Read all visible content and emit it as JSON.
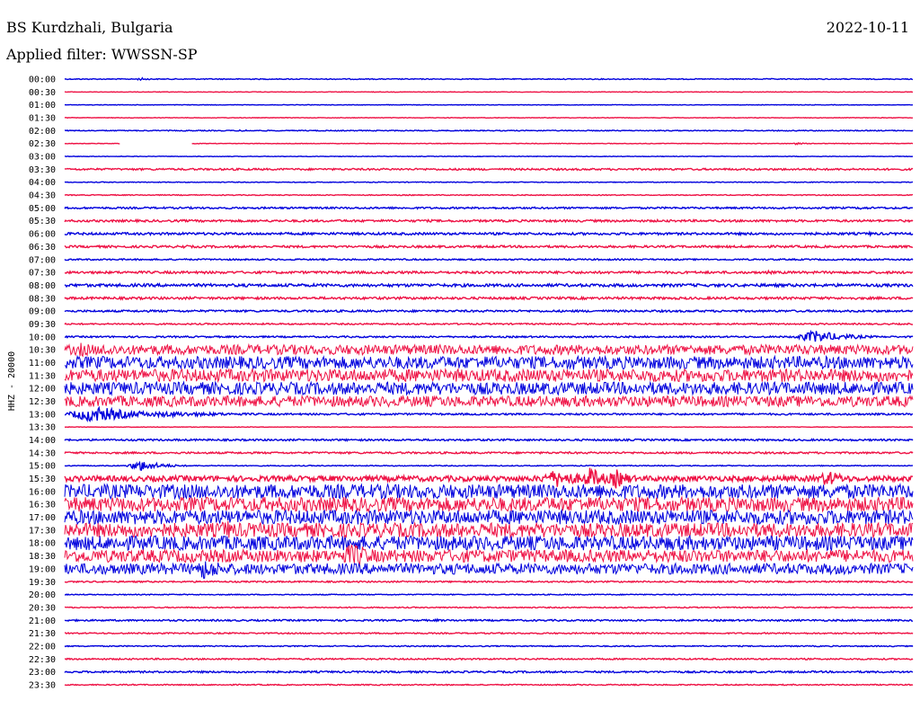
{
  "header": {
    "station": "BS Kurdzhali, Bulgaria",
    "date": "2022-10-11",
    "filter": "Applied filter: WWSSN-SP"
  },
  "chart_data": {
    "type": "line",
    "title": "BS Kurdzhali, Bulgaria",
    "ylabel": "HHZ - 20000",
    "colors": {
      "even": "#0000dd",
      "odd": "#ee1144"
    },
    "rows": [
      {
        "label": "00:00",
        "amp": 0.5,
        "events": [
          {
            "x": 0.09,
            "a": 1.5,
            "w": 0.01
          }
        ]
      },
      {
        "label": "00:30",
        "amp": 0.3,
        "events": []
      },
      {
        "label": "01:00",
        "amp": 0.3,
        "events": []
      },
      {
        "label": "01:30",
        "amp": 0.3,
        "events": []
      },
      {
        "label": "02:00",
        "amp": 0.5,
        "events": [
          {
            "x": 0.21,
            "a": 1.2,
            "w": 0.01
          }
        ]
      },
      {
        "label": "02:30",
        "amp": 0.3,
        "events": [
          {
            "x": 0.86,
            "a": 1.2,
            "w": 0.01
          }
        ],
        "gap": [
          0.065,
          0.15
        ]
      },
      {
        "label": "03:00",
        "amp": 0.3,
        "events": []
      },
      {
        "label": "03:30",
        "amp": 1.0,
        "events": []
      },
      {
        "label": "04:00",
        "amp": 0.4,
        "events": []
      },
      {
        "label": "04:30",
        "amp": 0.5,
        "events": []
      },
      {
        "label": "05:00",
        "amp": 1.0,
        "events": [
          {
            "x": 0.94,
            "a": 2,
            "w": 0.01
          }
        ]
      },
      {
        "label": "05:30",
        "amp": 1.2,
        "events": []
      },
      {
        "label": "06:00",
        "amp": 1.3,
        "events": [
          {
            "x": 0.95,
            "a": 2,
            "w": 0.01
          }
        ]
      },
      {
        "label": "06:30",
        "amp": 1.2,
        "events": [
          {
            "x": 0.14,
            "a": 2,
            "w": 0.01
          }
        ]
      },
      {
        "label": "07:00",
        "amp": 0.8,
        "events": []
      },
      {
        "label": "07:30",
        "amp": 1.3,
        "events": [
          {
            "x": 0.83,
            "a": 2,
            "w": 0.01
          }
        ]
      },
      {
        "label": "08:00",
        "amp": 1.6,
        "events": []
      },
      {
        "label": "08:30",
        "amp": 1.3,
        "events": []
      },
      {
        "label": "09:00",
        "amp": 1.1,
        "events": []
      },
      {
        "label": "09:30",
        "amp": 0.8,
        "events": []
      },
      {
        "label": "10:00",
        "amp": 0.9,
        "events": [
          {
            "x": 0.885,
            "a": 7,
            "w": 0.03
          }
        ]
      },
      {
        "label": "10:30",
        "amp": 5.5,
        "events": [
          {
            "x": 0.02,
            "a": 8,
            "w": 0.03
          },
          {
            "x": 0.05,
            "a": 9,
            "w": 0.015
          }
        ]
      },
      {
        "label": "11:00",
        "amp": 7.0,
        "events": [
          {
            "x": 0.6,
            "a": 9,
            "w": 0.01
          }
        ]
      },
      {
        "label": "11:30",
        "amp": 7.0,
        "events": []
      },
      {
        "label": "12:00",
        "amp": 7.0,
        "events": []
      },
      {
        "label": "12:30",
        "amp": 6.0,
        "events": []
      },
      {
        "label": "13:00",
        "amp": 1.0,
        "events": [
          {
            "x": 0.035,
            "a": 9,
            "w": 0.04
          },
          {
            "x": 0.12,
            "a": 3,
            "w": 0.08
          }
        ]
      },
      {
        "label": "13:30",
        "amp": 0.3,
        "events": []
      },
      {
        "label": "14:00",
        "amp": 1.0,
        "events": []
      },
      {
        "label": "14:30",
        "amp": 1.0,
        "events": []
      },
      {
        "label": "15:00",
        "amp": 0.5,
        "events": [
          {
            "x": 0.09,
            "a": 6,
            "w": 0.02
          }
        ]
      },
      {
        "label": "15:30",
        "amp": 3.0,
        "events": [
          {
            "x": 0.58,
            "a": 10,
            "w": 0.03
          },
          {
            "x": 0.62,
            "a": 13,
            "w": 0.015
          },
          {
            "x": 0.65,
            "a": 11,
            "w": 0.015
          },
          {
            "x": 0.9,
            "a": 9,
            "w": 0.02
          }
        ]
      },
      {
        "label": "16:00",
        "amp": 8.0,
        "events": []
      },
      {
        "label": "16:30",
        "amp": 8.0,
        "events": []
      },
      {
        "label": "17:00",
        "amp": 8.0,
        "events": []
      },
      {
        "label": "17:30",
        "amp": 8.0,
        "events": [
          {
            "x": 0.19,
            "a": 12,
            "w": 0.02
          }
        ]
      },
      {
        "label": "18:00",
        "amp": 8.0,
        "events": []
      },
      {
        "label": "18:30",
        "amp": 7.0,
        "events": [
          {
            "x": 0.34,
            "a": 14,
            "w": 0.03
          }
        ]
      },
      {
        "label": "19:00",
        "amp": 6.0,
        "events": [
          {
            "x": 0.165,
            "a": 12,
            "w": 0.03
          }
        ]
      },
      {
        "label": "19:30",
        "amp": 0.8,
        "events": []
      },
      {
        "label": "20:00",
        "amp": 0.5,
        "events": []
      },
      {
        "label": "20:30",
        "amp": 0.6,
        "events": []
      },
      {
        "label": "21:00",
        "amp": 0.9,
        "events": [
          {
            "x": 0.44,
            "a": 1.5,
            "w": 0.01
          }
        ]
      },
      {
        "label": "21:30",
        "amp": 0.7,
        "events": []
      },
      {
        "label": "22:00",
        "amp": 0.6,
        "events": []
      },
      {
        "label": "22:30",
        "amp": 0.8,
        "events": []
      },
      {
        "label": "23:00",
        "amp": 1.0,
        "events": []
      },
      {
        "label": "23:30",
        "amp": 0.6,
        "events": []
      }
    ]
  }
}
